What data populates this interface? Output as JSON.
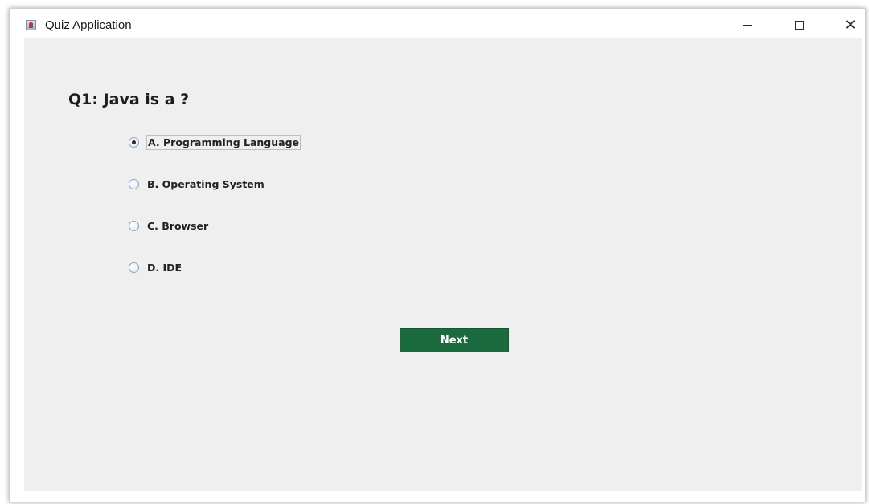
{
  "window": {
    "title": "Quiz Application",
    "controls": {
      "minimize": "minimize",
      "maximize": "maximize",
      "close": "✕"
    }
  },
  "quiz": {
    "question": "Q1: Java is a ?",
    "options": [
      {
        "label": "A. Programming Language",
        "selected": true
      },
      {
        "label": "B. Operating System",
        "selected": false
      },
      {
        "label": "C. Browser",
        "selected": false
      },
      {
        "label": "D. IDE",
        "selected": false
      }
    ],
    "next_label": "Next"
  },
  "colors": {
    "next_button_bg": "#1c6b3e",
    "panel_bg": "#efefef"
  }
}
